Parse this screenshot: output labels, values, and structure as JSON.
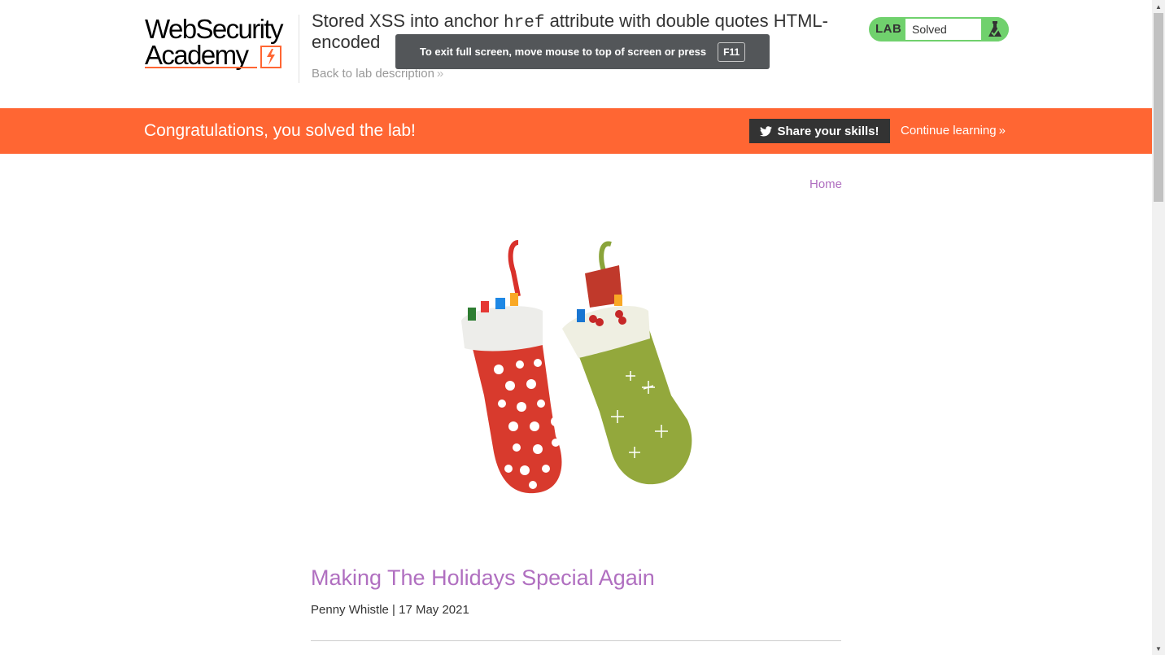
{
  "header": {
    "logo_line1": "WebSecurity",
    "logo_line2": "Academy",
    "lab_title_part1": "Stored XSS into anchor ",
    "lab_title_code": "href",
    "lab_title_part2": " attribute with double quotes HTML-encoded",
    "back_link": "Back to lab description",
    "back_chevron": "»",
    "lab_badge_label": "LAB",
    "lab_status": "Solved"
  },
  "fullscreen_toast": {
    "message": "To exit full screen, move mouse to top of screen or press",
    "key": "F11"
  },
  "banner": {
    "message": "Congratulations, you solved the lab!",
    "share_button": "Share your skills!",
    "continue_link": "Continue learning",
    "continue_chevron": "»"
  },
  "nav": {
    "home": "Home"
  },
  "post": {
    "title": "Making The Holidays Special Again",
    "meta": "Penny Whistle | 17 May 2021"
  },
  "colors": {
    "brand_orange": "#ff6633",
    "lab_green": "#70d16d",
    "link_purple": "#b06fc0",
    "dark": "#333333"
  },
  "icons": [
    "logo-lightning-icon",
    "flask-icon",
    "twitter-icon",
    "chevron-right-icon"
  ]
}
